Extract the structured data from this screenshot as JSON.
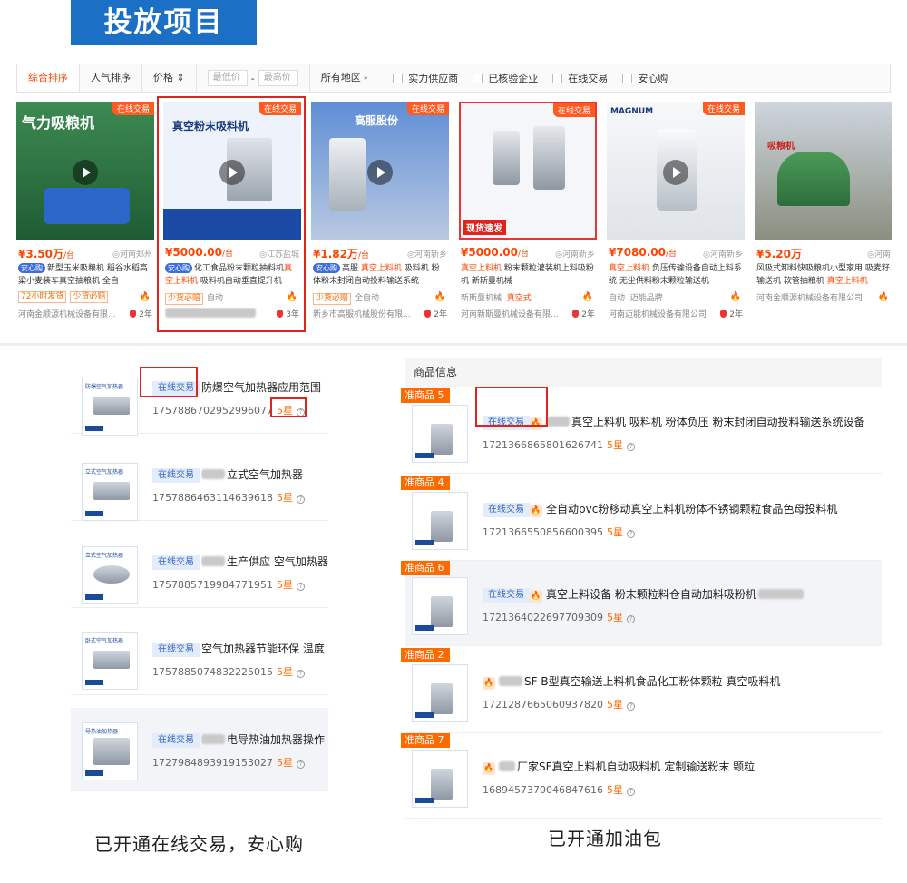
{
  "header": {
    "title": "投放项目"
  },
  "filters": {
    "sort_items": [
      "综合排序",
      "人气排序",
      "价格"
    ],
    "min_price_placeholder": "最低价",
    "max_price_placeholder": "最高价",
    "dash": "-",
    "region": "所有地区",
    "checks": [
      "实力供应商",
      "已核验企业",
      "在线交易",
      "安心购"
    ]
  },
  "cards": [
    {
      "badge": "在线交易",
      "price": "¥3.50万",
      "unit": "/台",
      "loc": "河南郑州",
      "tag": "安心购",
      "desc": "新型玉米吸粮机 稻谷水稻高粱小麦装车真空抽粮机 全自",
      "tags": [
        "72小时发货",
        "少货必赔"
      ],
      "company": "河南金顺源机械设备有限...",
      "years": "2年",
      "img_text": "气力吸粮机"
    },
    {
      "badge": "在线交易",
      "price": "¥5000.00",
      "unit": "/台",
      "loc": "江苏盐城",
      "tag": "安心购",
      "desc": "化工食品粉末颗粒抽料机真空上料机 吸料机自动垂直提升机",
      "tags": [
        "少货必赔",
        "自动"
      ],
      "company": "",
      "years": "3年",
      "img_text": "真空粉末吸料机"
    },
    {
      "badge": "在线交易",
      "price": "¥1.82万",
      "unit": "/台",
      "loc": "河南新乡",
      "tag": "安心购",
      "desc": "高服 真空上料机 吸料机 粉体粉末封闭自动投料输送系统",
      "tags": [
        "少货必赔",
        "全自动"
      ],
      "company": "新乡市高服机械股份有限...",
      "years": "2年",
      "img_text": "高服股份"
    },
    {
      "badge": "在线交易",
      "price": "¥5000.00",
      "unit": "/台",
      "loc": "河南新乡",
      "tag": "",
      "desc": "真空上料机 粉末颗粒灌装机上料吸粉机 新斯曼机械",
      "tags": [
        "新斯曼机械",
        "真空式"
      ],
      "company": "河南新斯曼机械设备有限...",
      "years": "2年",
      "img_text": "现货速发"
    },
    {
      "badge": "在线交易",
      "price": "¥7080.00",
      "unit": "/台",
      "loc": "河南新乡",
      "tag": "",
      "desc": "真空上料机 负压传输设备自动上料系统 无尘供料粉末颗粒输送机",
      "tags": [
        "自动",
        "迈能品牌"
      ],
      "company": "河南迈能机械设备有限公司",
      "years": "2年",
      "img_text": "MAGNUM"
    },
    {
      "badge": "在线交易",
      "price": "¥5.20万",
      "unit": "",
      "loc": "河南",
      "tag": "",
      "desc": "风吸式卸料快吸粮机小型家用 吸麦籽输送机 软管抽粮机 真空上料机",
      "tags": [],
      "company": "河南金顺源机械设备有限公司",
      "years": "",
      "img_text": "吸粮机"
    }
  ],
  "left_list": [
    {
      "tag": "在线交易",
      "title": "防爆空气加热器应用范围",
      "code": "1757886702952996077",
      "star": "5星",
      "thumb": "防爆空气加热器"
    },
    {
      "tag": "在线交易",
      "title": "立式空气加热器",
      "code": "1757886463114639618",
      "star": "5星",
      "thumb": "立式空气加热器"
    },
    {
      "tag": "在线交易",
      "title": "生产供应 空气加热器",
      "code": "1757885719984771951",
      "star": "5星",
      "thumb": "立式空气加热器"
    },
    {
      "tag": "在线交易",
      "title": "空气加热器节能环保 温度",
      "code": "1757885074832225015",
      "star": "5星",
      "thumb": "卧式空气加热器"
    },
    {
      "tag": "在线交易",
      "title": "电导热油加热器操作",
      "code": "1727984893919153027",
      "star": "5星",
      "thumb": "导热油加热器"
    }
  ],
  "right_list": {
    "header": "商品信息",
    "rows": [
      {
        "rank": "准商品 5",
        "tag": "在线交易",
        "title": "真空上料机 吸料机 粉体负压 粉末封闭自动投料输送系统设备",
        "code": "1721366865801626741",
        "star": "5星"
      },
      {
        "rank": "准商品 4",
        "tag": "在线交易",
        "title": "全自动pvc粉移动真空上料机粉体不锈钢颗粒食品色母投料机",
        "code": "1721366550856600395",
        "star": "5星"
      },
      {
        "rank": "准商品 6",
        "tag": "在线交易",
        "title": "真空上料设备 粉末颗粒料仓自动加料吸粉机",
        "code": "1721364022697709309",
        "star": "5星"
      },
      {
        "rank": "准商品 2",
        "tag": "",
        "title": "SF-B型真空输送上料机食品化工粉体颗粒 真空吸料机",
        "code": "1721287665060937820",
        "star": "5星"
      },
      {
        "rank": "准商品 7",
        "tag": "",
        "title": "厂家SF真空上料机自动吸料机 定制输送粉末 颗粒",
        "code": "1689457370046847616",
        "star": "5星"
      }
    ]
  },
  "captions": {
    "left": "已开通在线交易，安心购",
    "right": "已开通加油包"
  },
  "colors": {
    "brand": "#1b6fc4",
    "accent": "#ff4400",
    "highlight": "#e0231f",
    "online_tag": "#3465c4"
  }
}
